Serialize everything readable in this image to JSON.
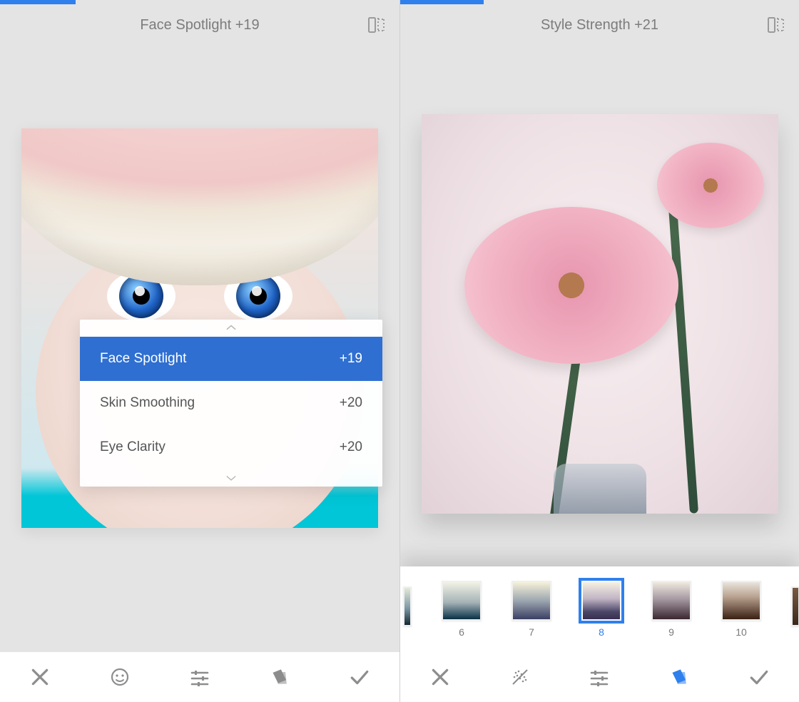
{
  "left": {
    "header": {
      "title": "Face Spotlight +19"
    },
    "progress_percent": 19,
    "panel": {
      "rows": [
        {
          "label": "Face Spotlight",
          "value": "+19",
          "active": true
        },
        {
          "label": "Skin Smoothing",
          "value": "+20",
          "active": false
        },
        {
          "label": "Eye Clarity",
          "value": "+20",
          "active": false
        }
      ]
    },
    "toolbar": {
      "items": [
        {
          "name": "cancel-button",
          "icon": "close-icon",
          "active": false
        },
        {
          "name": "face-button",
          "icon": "face-icon",
          "active": false
        },
        {
          "name": "tune-button",
          "icon": "sliders-icon",
          "active": false
        },
        {
          "name": "styles-button",
          "icon": "palette-icon",
          "active": false
        },
        {
          "name": "apply-button",
          "icon": "check-icon",
          "active": false
        }
      ]
    }
  },
  "right": {
    "header": {
      "title": "Style Strength +21"
    },
    "progress_percent": 21,
    "filters": [
      {
        "label": "",
        "grad": "g1",
        "active": false,
        "edge": "first"
      },
      {
        "label": "6",
        "grad": "g2",
        "active": false
      },
      {
        "label": "7",
        "grad": "g3",
        "active": false
      },
      {
        "label": "8",
        "grad": "g4",
        "active": true
      },
      {
        "label": "9",
        "grad": "g5",
        "active": false
      },
      {
        "label": "10",
        "grad": "g6",
        "active": false
      },
      {
        "label": "",
        "grad": "g7",
        "active": false,
        "edge": "last"
      }
    ],
    "toolbar": {
      "items": [
        {
          "name": "cancel-button",
          "icon": "close-icon",
          "active": false
        },
        {
          "name": "crosshatch-button",
          "icon": "scatter-icon",
          "active": false
        },
        {
          "name": "tune-button",
          "icon": "sliders-icon",
          "active": false
        },
        {
          "name": "styles-button",
          "icon": "palette-icon",
          "active": true
        },
        {
          "name": "apply-button",
          "icon": "check-icon",
          "active": false
        }
      ]
    }
  }
}
